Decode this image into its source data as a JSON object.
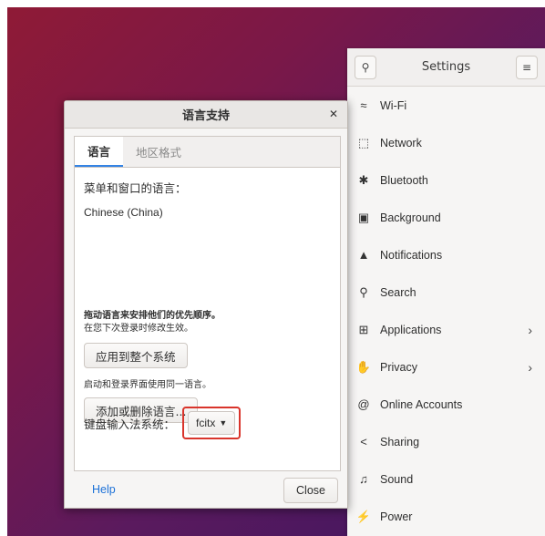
{
  "settings": {
    "title": "Settings",
    "items": [
      {
        "label": "Wi-Fi",
        "icon": "wifi-icon",
        "glyph": "≈",
        "chevron": false
      },
      {
        "label": "Network",
        "icon": "network-icon",
        "glyph": "⬚",
        "chevron": false
      },
      {
        "label": "Bluetooth",
        "icon": "bluetooth-icon",
        "glyph": "✱",
        "chevron": false
      },
      {
        "label": "Background",
        "icon": "background-icon",
        "glyph": "▣",
        "chevron": false
      },
      {
        "label": "Notifications",
        "icon": "notifications-icon",
        "glyph": "▲",
        "chevron": false
      },
      {
        "label": "Search",
        "icon": "search-icon",
        "glyph": "⚲",
        "chevron": false
      },
      {
        "label": "Applications",
        "icon": "applications-icon",
        "glyph": "⊞",
        "chevron": true
      },
      {
        "label": "Privacy",
        "icon": "privacy-icon",
        "glyph": "✋",
        "chevron": true
      },
      {
        "label": "Online Accounts",
        "icon": "online-accounts-icon",
        "glyph": "@",
        "chevron": false
      },
      {
        "label": "Sharing",
        "icon": "sharing-icon",
        "glyph": "<",
        "chevron": false
      },
      {
        "label": "Sound",
        "icon": "sound-icon",
        "glyph": "♫",
        "chevron": false
      },
      {
        "label": "Power",
        "icon": "power-icon",
        "glyph": "⚡",
        "chevron": false
      }
    ]
  },
  "dialog": {
    "title": "语言支持",
    "tabs": [
      "语言",
      "地区格式"
    ],
    "menu_lang_label": "菜单和窗口的语言：",
    "languages": [
      "Chinese (China)"
    ],
    "drag_hint": "拖动语言来安排他们的优先顺序。",
    "relogin_hint": "在您下次登录时修改生效。",
    "apply_button": "应用到整个系统",
    "login_hint": "启动和登录界面使用同一语言。",
    "add_remove_button": "添加或删除语言...",
    "im_label": "键盘输入法系统：",
    "im_value": "fcitx",
    "help": "Help",
    "close": "Close"
  },
  "colors": {
    "accent": "#3584e4",
    "highlight": "#d9342b",
    "link": "#1c71d8"
  }
}
